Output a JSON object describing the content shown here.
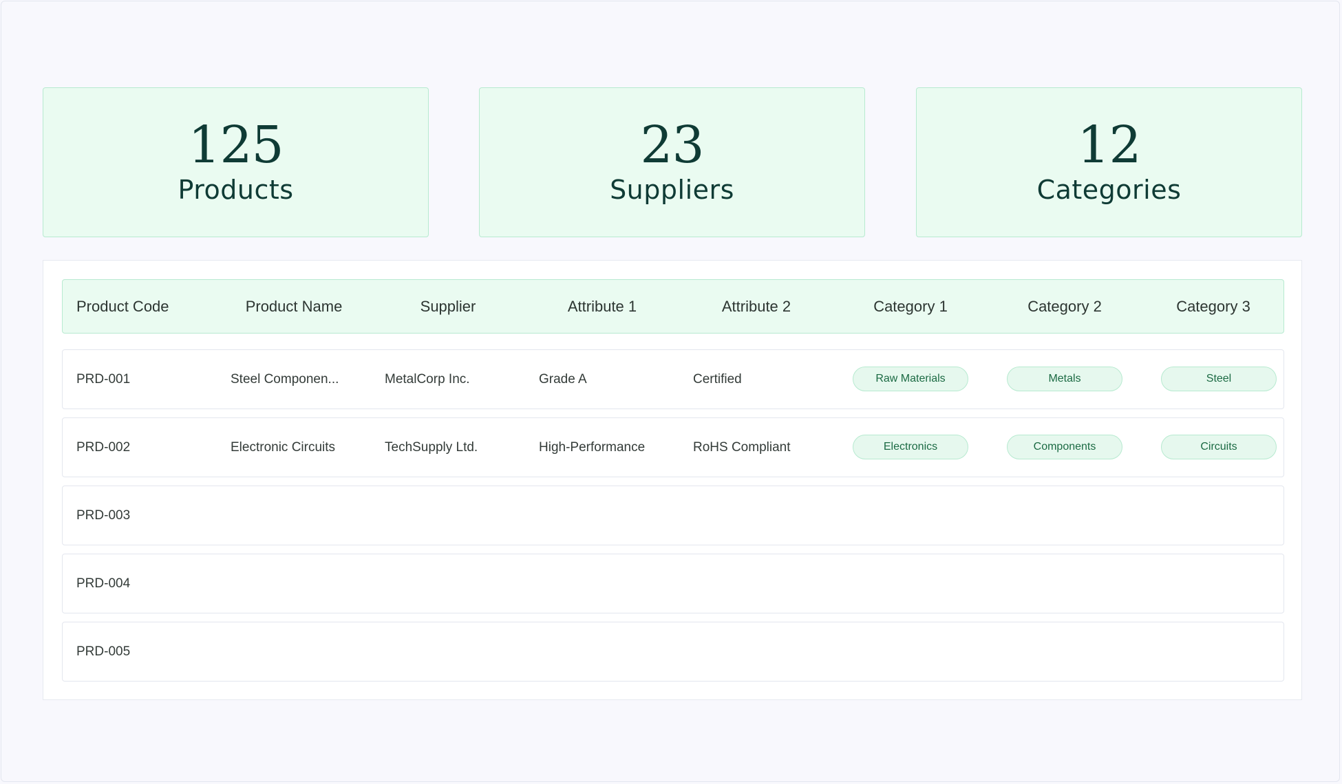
{
  "stats": [
    {
      "value": "125",
      "label": "Products"
    },
    {
      "value": "23",
      "label": "Suppliers"
    },
    {
      "value": "12",
      "label": "Categories"
    }
  ],
  "table": {
    "headers": [
      "Product Code",
      "Product Name",
      "Supplier",
      "Attribute 1",
      "Attribute 2",
      "Category 1",
      "Category 2",
      "Category 3"
    ],
    "rows": [
      {
        "code": "PRD-001",
        "name": "Steel Componen...",
        "supplier": "MetalCorp Inc.",
        "attr1": "Grade A",
        "attr2": "Certified",
        "cat1": "Raw Materials",
        "cat2": "Metals",
        "cat3": "Steel"
      },
      {
        "code": "PRD-002",
        "name": "Electronic Circuits",
        "supplier": "TechSupply Ltd.",
        "attr1": "High-Performance",
        "attr2": "RoHS Compliant",
        "cat1": "Electronics",
        "cat2": "Components",
        "cat3": "Circuits"
      },
      {
        "code": "PRD-003"
      },
      {
        "code": "PRD-004"
      },
      {
        "code": "PRD-005"
      }
    ]
  },
  "colors": {
    "card_bg": "#eafbf1",
    "card_border": "#b7ead0",
    "heading_text": "#0f3b35",
    "pill_text": "#1b6a43"
  }
}
